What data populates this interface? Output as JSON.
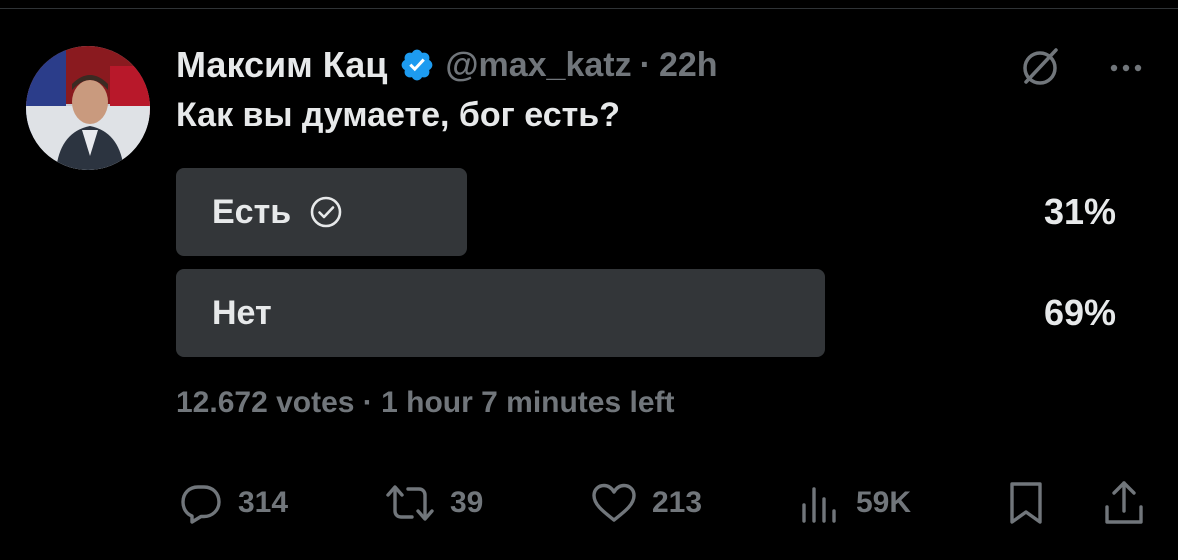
{
  "tweet": {
    "display_name": "Максим Кац",
    "handle": "@max_katz",
    "separator": "·",
    "timestamp": "22h",
    "text": "Как вы думаете, бог есть?"
  },
  "poll": {
    "options": [
      {
        "label": "Есть",
        "percent": "31%",
        "fill_fraction": 0.31,
        "selected": true
      },
      {
        "label": "Нет",
        "percent": "69%",
        "fill_fraction": 0.69,
        "selected": false
      }
    ],
    "meta": "12.672 votes · 1 hour 7 minutes left"
  },
  "actions": {
    "replies": "314",
    "reposts": "39",
    "likes": "213",
    "views": "59K"
  },
  "icons": {
    "verified": "verified-badge-icon",
    "grok": "grok-icon",
    "more": "more-icon",
    "check": "check-circle-icon",
    "reply": "reply-icon",
    "repost": "repost-icon",
    "like": "heart-icon",
    "views": "views-icon",
    "bookmark": "bookmark-icon",
    "share": "share-icon"
  },
  "colors": {
    "background": "#000000",
    "text_primary": "#e7e9ea",
    "text_secondary": "#71767b",
    "poll_fill": "#333639",
    "verified_blue": "#1d9bf0"
  }
}
